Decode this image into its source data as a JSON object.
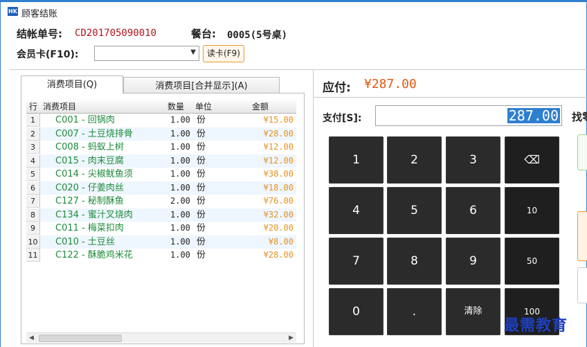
{
  "window": {
    "title": "顾客结账",
    "icon_text": "HK"
  },
  "header": {
    "order_label": "结帐单号:",
    "order_no": "CD201705090010",
    "table_label": "餐台:",
    "table_value": "0005(5号桌)"
  },
  "member": {
    "label": "会员卡(F10):",
    "value": "",
    "read_button": "读卡(F9)"
  },
  "tabs": [
    {
      "label": "消费项目(Q)"
    },
    {
      "label": "消费项目[合并显示](A)"
    }
  ],
  "grid": {
    "columns": {
      "row": "行",
      "item": "消费项目",
      "qty": "数量",
      "unit": "单位",
      "amount": "金额"
    },
    "rows": [
      {
        "n": "1",
        "item": "C001 - 回锅肉",
        "qty": "1.00",
        "unit": "份",
        "amount": "¥15.00"
      },
      {
        "n": "2",
        "item": "C007 - 土豆烧排骨",
        "qty": "1.00",
        "unit": "份",
        "amount": "¥28.00"
      },
      {
        "n": "3",
        "item": "C008 - 蚂蚁上树",
        "qty": "1.00",
        "unit": "份",
        "amount": "¥12.00"
      },
      {
        "n": "4",
        "item": "C015 - 肉末豆腐",
        "qty": "1.00",
        "unit": "份",
        "amount": "¥12.00"
      },
      {
        "n": "5",
        "item": "C014 - 尖椒鱿鱼须",
        "qty": "1.00",
        "unit": "份",
        "amount": "¥38.00"
      },
      {
        "n": "6",
        "item": "C020 - 仔姜肉丝",
        "qty": "1.00",
        "unit": "份",
        "amount": "¥18.00"
      },
      {
        "n": "7",
        "item": "C127 - 秘制酥鱼",
        "qty": "2.00",
        "unit": "份",
        "amount": "¥76.00"
      },
      {
        "n": "8",
        "item": "C134 - 蜜汁叉烧肉",
        "qty": "1.00",
        "unit": "份",
        "amount": "¥32.00"
      },
      {
        "n": "9",
        "item": "C011 - 梅菜扣肉",
        "qty": "1.00",
        "unit": "份",
        "amount": "¥20.00"
      },
      {
        "n": "10",
        "item": "C010 - 土豆丝",
        "qty": "1.00",
        "unit": "份",
        "amount": "¥8.00"
      },
      {
        "n": "11",
        "item": "C122 - 酥脆鸡米花",
        "qty": "1.00",
        "unit": "份",
        "amount": "¥28.00"
      }
    ]
  },
  "payment": {
    "due_label": "应付:",
    "due_value": "¥287.00",
    "pay_label": "支付[S]:",
    "pay_value": "287.00",
    "change_label": "找零"
  },
  "keypad": {
    "k1": "1",
    "k2": "2",
    "k3": "3",
    "kback": "⌫",
    "k4": "4",
    "k5": "5",
    "k6": "6",
    "k10": "10",
    "k7": "7",
    "k8": "8",
    "k9": "9",
    "k50": "50",
    "k0": "0",
    "kdot": ".",
    "kclear": "清除",
    "k100": "100"
  },
  "watermark": "最需教育",
  "colors": {
    "accent": "#2f7fd0",
    "order_no": "#b0141c",
    "item_text": "#1e8a3a",
    "amount": "#e89020",
    "due": "#e05a10"
  }
}
